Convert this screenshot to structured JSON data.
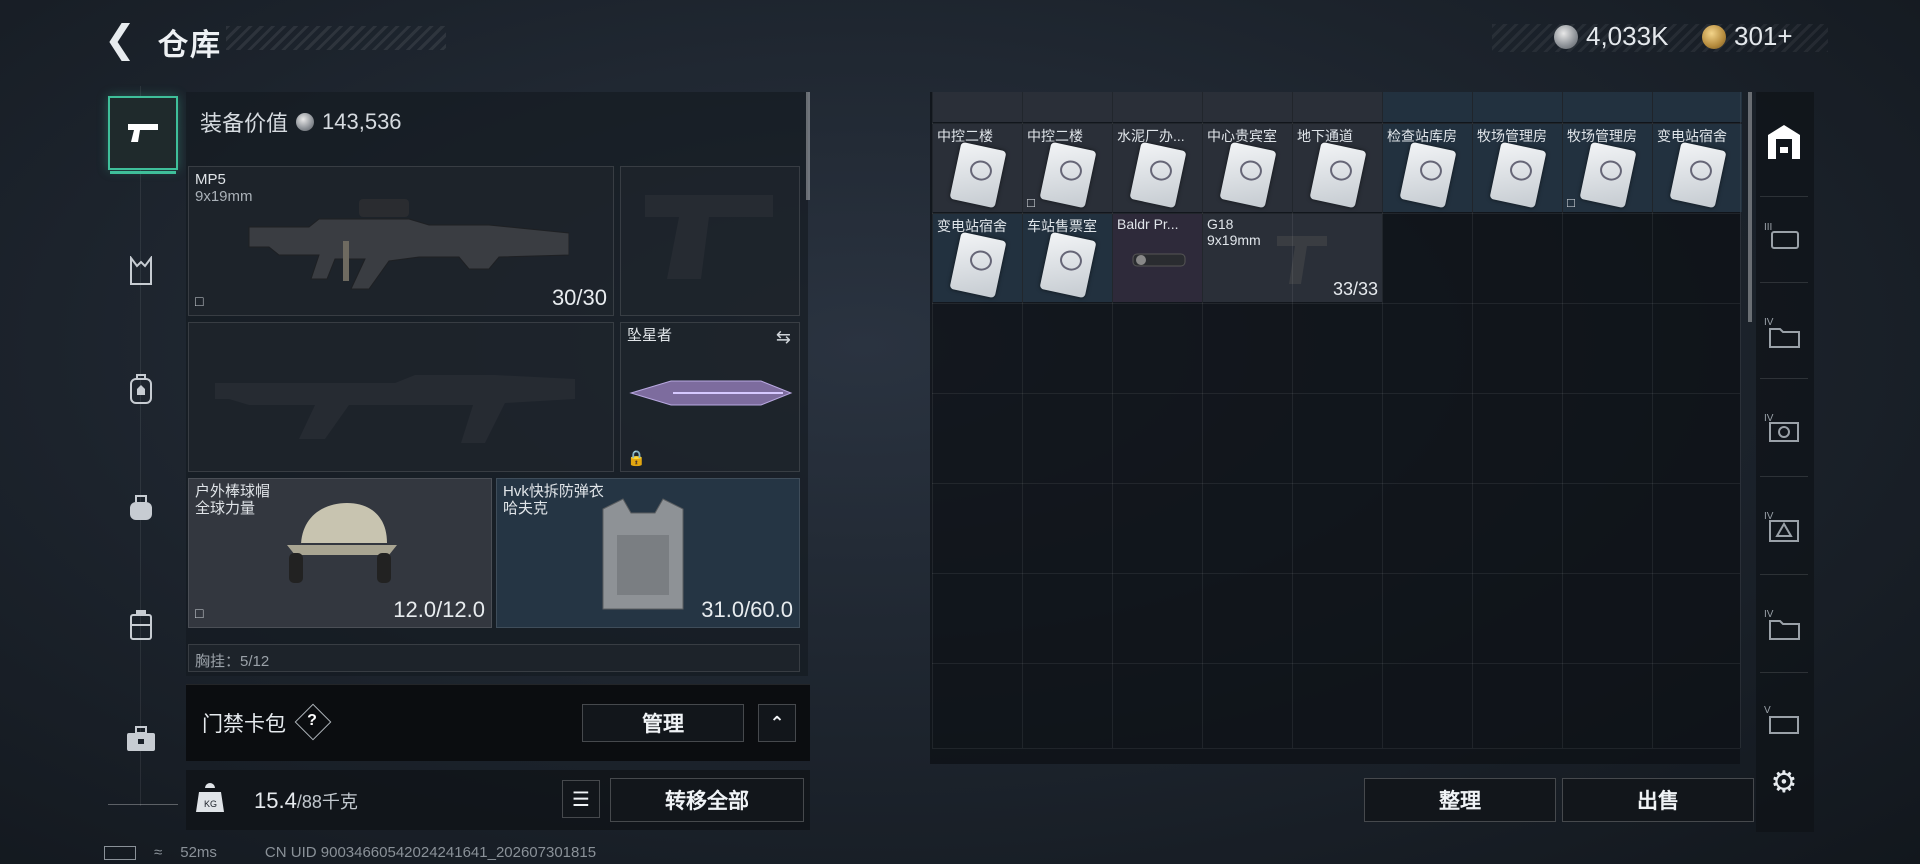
{
  "header": {
    "back_icon": "arrow-left-icon",
    "title": "仓库"
  },
  "currency": {
    "silver": "4,033K",
    "gold": "301+"
  },
  "rail": {
    "items": [
      {
        "icon": "pistol-icon",
        "active": true
      },
      {
        "icon": "vest-icon"
      },
      {
        "icon": "backpack-icon"
      },
      {
        "icon": "bag-icon"
      },
      {
        "icon": "case-icon"
      },
      {
        "icon": "toolbox-icon"
      }
    ]
  },
  "equipment": {
    "value_label": "装备价值",
    "value": "143,536",
    "primary": {
      "name": "MP5",
      "ammo": "9x19mm",
      "count": "30/30"
    },
    "melee": {
      "name": "坠星者"
    },
    "helmet": {
      "name": "户外棒球帽",
      "sub": "全球力量",
      "count": "12.0/12.0"
    },
    "armor": {
      "name": "Hvk快拆防弹衣",
      "sub": "哈夫克",
      "count": "31.0/60.0"
    },
    "chest_partial": "胸挂：5/12"
  },
  "keycard": {
    "label": "门禁卡包",
    "help": "?",
    "manage": "管理"
  },
  "weight": {
    "current": "15.4",
    "max": "/88千克",
    "transfer_all": "转移全部"
  },
  "status": {
    "ping": "52ms",
    "uid": "CN UID 9003466054202424164​1_202607301815"
  },
  "grid": {
    "row1": [
      "中控二楼",
      "中控二楼",
      "水泥厂办...",
      "中心贵宾室",
      "地下通道",
      "检查站库房",
      "牧场管理房",
      "牧场管理房",
      "变电站宿舍"
    ],
    "row2": [
      "变电站宿舍",
      "车站售票室",
      "Baldr Pr...",
      "G18"
    ],
    "g18_ammo": "9x19mm",
    "g18_count": "33/33"
  },
  "actions": {
    "sort": "整理",
    "sell": "出售"
  }
}
